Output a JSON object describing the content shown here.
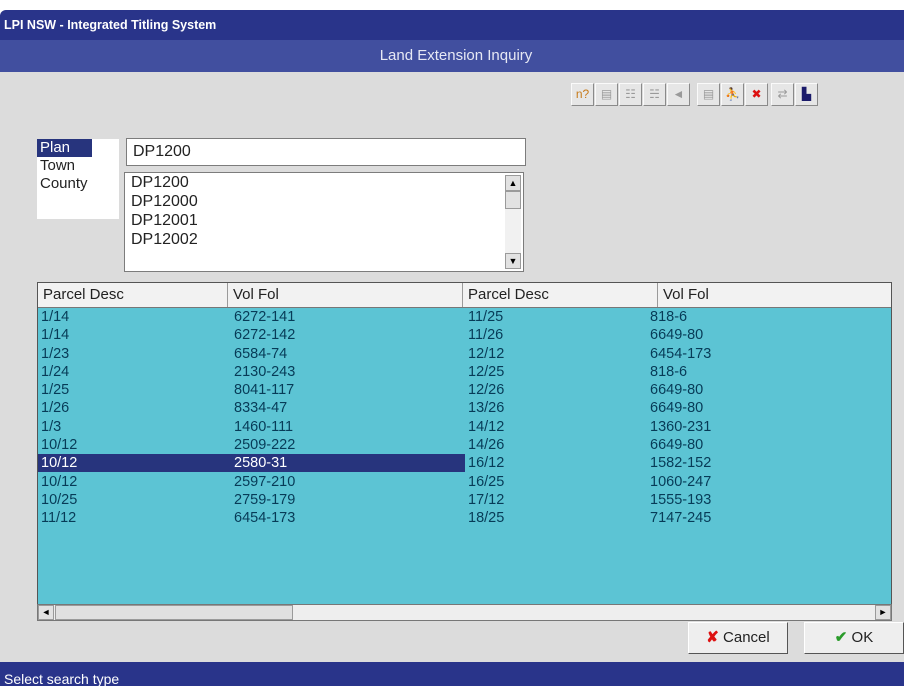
{
  "window": {
    "title": "LPI NSW - Integrated Titling System"
  },
  "dialog": {
    "title": "Land Extension Inquiry"
  },
  "toolbar": {
    "buttons": [
      {
        "icon": "help-icon",
        "glyph": "n?"
      },
      {
        "icon": "document-icon",
        "glyph": "▤"
      },
      {
        "icon": "list-icon",
        "glyph": "☷"
      },
      {
        "icon": "list-alt-icon",
        "glyph": "☵"
      },
      {
        "icon": "back-arrow-icon",
        "glyph": "◄"
      },
      {
        "icon": "page-icon",
        "glyph": "▤"
      },
      {
        "icon": "exit-person-icon",
        "glyph": "⛹"
      },
      {
        "icon": "delete-icon",
        "glyph": "✖"
      },
      {
        "icon": "swap-icon",
        "glyph": "⇄"
      },
      {
        "icon": "print-icon",
        "glyph": "▙"
      }
    ]
  },
  "search_type": {
    "options": [
      "Plan",
      "Town",
      "County"
    ],
    "selected": "Plan"
  },
  "search": {
    "value": "DP1200",
    "suggestions": [
      "DP1200",
      "DP12000",
      "DP12001",
      "DP12002"
    ]
  },
  "grid": {
    "columns": [
      "Parcel Desc",
      "Vol Fol",
      "Parcel Desc",
      "Vol Fol"
    ],
    "rows": [
      [
        "1/14",
        "6272-141",
        "11/25",
        "818-6"
      ],
      [
        "1/14",
        "6272-142",
        "11/26",
        "6649-80"
      ],
      [
        "1/23",
        "6584-74",
        "12/12",
        "6454-173"
      ],
      [
        "1/24",
        "2130-243",
        "12/25",
        "818-6"
      ],
      [
        "1/25",
        "8041-117",
        "12/26",
        "6649-80"
      ],
      [
        "1/26",
        "8334-47",
        "13/26",
        "6649-80"
      ],
      [
        "1/3",
        "1460-111",
        "14/12",
        "1360-231"
      ],
      [
        "10/12",
        "2509-222",
        "14/26",
        "6649-80"
      ],
      [
        "10/12",
        "2580-31",
        "16/12",
        "1582-152"
      ],
      [
        "10/12",
        "2597-210",
        "16/25",
        "1060-247"
      ],
      [
        "10/25",
        "2759-179",
        "17/12",
        "1555-193"
      ],
      [
        "11/12",
        "6454-173",
        "18/25",
        "7147-245"
      ]
    ],
    "selected_row": 8
  },
  "buttons": {
    "cancel": "Cancel",
    "ok": "OK"
  },
  "status": {
    "text": "Select search type"
  },
  "colors": {
    "title_bar": "#29348a",
    "grid_bg": "#5cc4d4",
    "selection": "#27347d"
  }
}
